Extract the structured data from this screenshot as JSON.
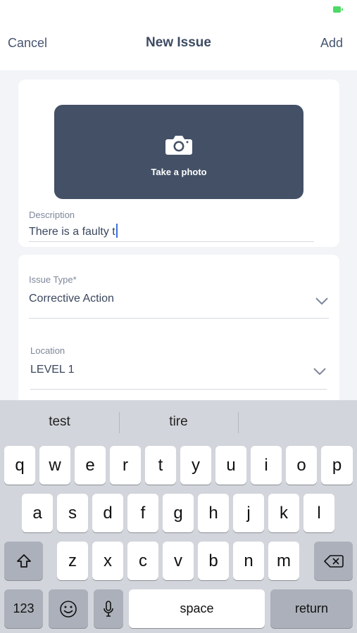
{
  "nav": {
    "cancel_label": "Cancel",
    "title": "New Issue",
    "add_label": "Add"
  },
  "photo": {
    "label": "Take a photo",
    "icon": "camera-icon"
  },
  "description": {
    "label": "Description",
    "value": "There is a faulty t"
  },
  "issue_type": {
    "label": "Issue Type*",
    "value": "Corrective Action"
  },
  "location": {
    "label": "Location",
    "value": "LEVEL 1"
  },
  "keyboard": {
    "suggestions": [
      "test",
      "tire",
      ""
    ],
    "row1": [
      "q",
      "w",
      "e",
      "r",
      "t",
      "y",
      "u",
      "i",
      "o",
      "p"
    ],
    "row2": [
      "a",
      "s",
      "d",
      "f",
      "g",
      "h",
      "j",
      "k",
      "l"
    ],
    "row3": [
      "z",
      "x",
      "c",
      "v",
      "b",
      "n",
      "m"
    ],
    "numbers_label": "123",
    "space_label": "space",
    "return_label": "return"
  },
  "colors": {
    "accent": "#435066",
    "battery": "#4cd964",
    "caret": "#3b6fe0",
    "keyboard_bg": "#d2d5db"
  }
}
